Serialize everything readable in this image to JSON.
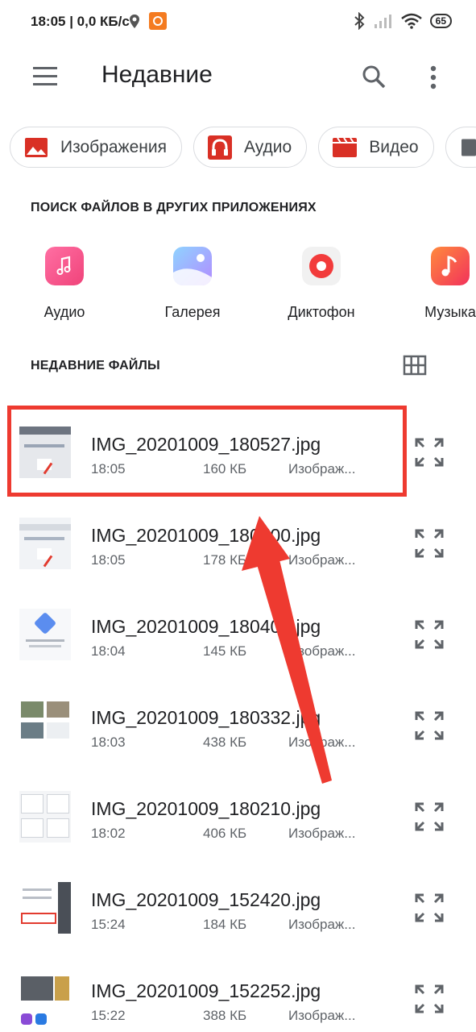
{
  "status_bar": {
    "text": "18:05 | 0,0 КБ/с",
    "battery": "65"
  },
  "app_bar": {
    "title": "Недавние",
    "menu_icon": "hamburger-menu-icon",
    "search_icon": "search-icon",
    "more_icon": "more-vertical-icon"
  },
  "chips": [
    {
      "label": "Изображения",
      "icon": "image-icon"
    },
    {
      "label": "Аудио",
      "icon": "headphones-icon"
    },
    {
      "label": "Видео",
      "icon": "video-icon"
    }
  ],
  "other_apps": {
    "title": "ПОИСК ФАЙЛОВ В ДРУГИХ ПРИЛОЖЕНИЯХ",
    "items": [
      {
        "label": "Аудио"
      },
      {
        "label": "Галерея"
      },
      {
        "label": "Диктофон"
      },
      {
        "label": "Музыка"
      }
    ]
  },
  "recent": {
    "title": "НЕДАВНИЕ ФАЙЛЫ",
    "files": [
      {
        "name": "IMG_20201009_180527.jpg",
        "time": "18:05",
        "size": "160 КБ",
        "type": "Изображ..."
      },
      {
        "name": "IMG_20201009_180500.jpg",
        "time": "18:05",
        "size": "178 КБ",
        "type": "Изображ..."
      },
      {
        "name": "IMG_20201009_180405.jpg",
        "time": "18:04",
        "size": "145 КБ",
        "type": "Изображ..."
      },
      {
        "name": "IMG_20201009_180332.jpg",
        "time": "18:03",
        "size": "438 КБ",
        "type": "Изображ..."
      },
      {
        "name": "IMG_20201009_180210.jpg",
        "time": "18:02",
        "size": "406 КБ",
        "type": "Изображ..."
      },
      {
        "name": "IMG_20201009_152420.jpg",
        "time": "15:24",
        "size": "184 КБ",
        "type": "Изображ..."
      },
      {
        "name": "IMG_20201009_152252.jpg",
        "time": "15:22",
        "size": "388 КБ",
        "type": "Изображ..."
      }
    ]
  },
  "colors": {
    "accent_red": "#ee3a30",
    "chip_icon_red": "#d93025"
  }
}
